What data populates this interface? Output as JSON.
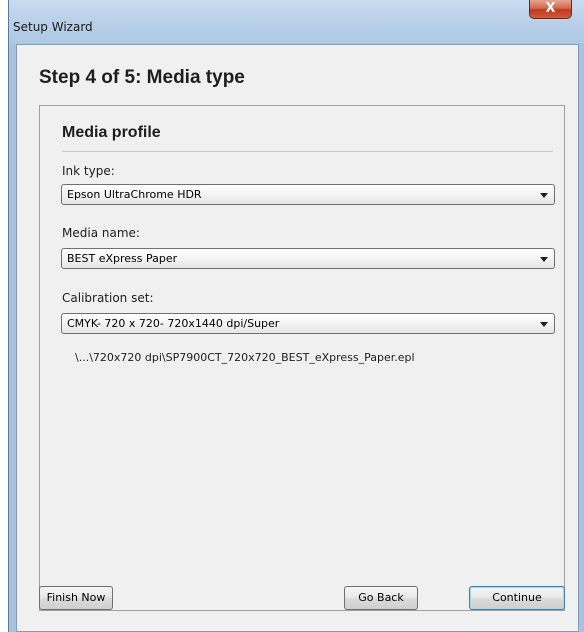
{
  "window": {
    "title": "Setup Wizard",
    "close_glyph": "X"
  },
  "step": {
    "title": "Step 4 of 5: Media type"
  },
  "media_profile": {
    "section_title": "Media profile",
    "ink_type": {
      "label": "Ink type:",
      "value": "Epson UltraChrome HDR"
    },
    "media_name": {
      "label": "Media name:",
      "value": "BEST eXpress Paper"
    },
    "calibration_set": {
      "label": "Calibration set:",
      "value": "CMYK- 720 x 720- 720x1440 dpi/Super"
    },
    "calibration_file_path": "\\...\\720x720 dpi\\SP7900CT_720x720_BEST_eXpress_Paper.epl"
  },
  "buttons": {
    "finish_now": "Finish Now",
    "go_back": "Go Back",
    "continue": "Continue"
  },
  "colors": {
    "window_frame": "#a9c3de",
    "close_button": "#c7432a",
    "default_button_border": "#3c7fb1"
  },
  "icons": {
    "close": "close-icon",
    "dropdown": "chevron-down-icon"
  }
}
